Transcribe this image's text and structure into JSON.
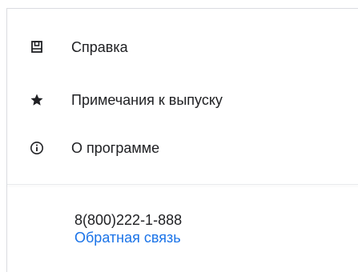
{
  "menu": {
    "items": [
      {
        "icon": "book-icon",
        "label": "Справка"
      },
      {
        "icon": "star-icon",
        "label": "Примечания к выпуску"
      },
      {
        "icon": "info-icon",
        "label": "О программе"
      }
    ]
  },
  "footer": {
    "phone": "8(800)222-1-888",
    "feedback_label": "Обратная связь",
    "link_color": "#1a73e8"
  }
}
